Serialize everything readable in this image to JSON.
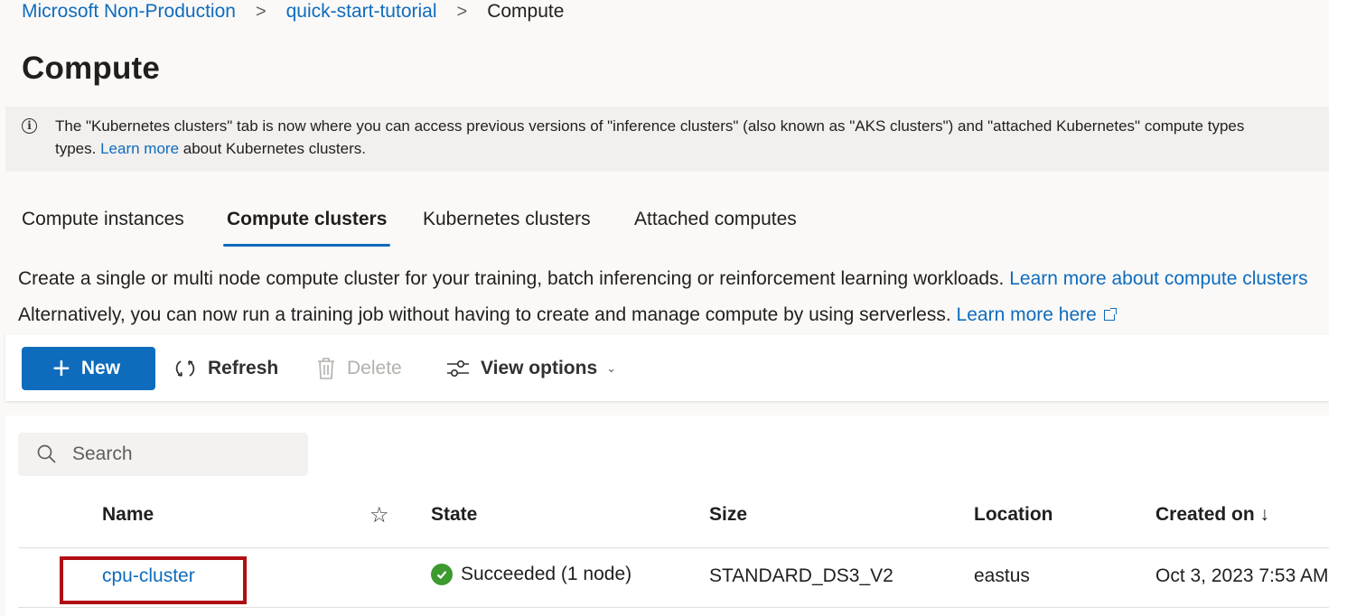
{
  "breadcrumb": {
    "items": [
      "Microsoft Non-Production",
      "quick-start-tutorial"
    ],
    "current": "Compute",
    "separator": ">"
  },
  "page": {
    "title": "Compute"
  },
  "banner": {
    "icon": "info-icon",
    "line1": "The \"Kubernetes clusters\" tab is now where you can access previous versions of \"inference clusters\" (also known as \"AKS clusters\") and \"attached Kubernetes\" compute types",
    "line2_pre": "types.",
    "line2_link": "Learn more",
    "line2_post": "about Kubernetes clusters."
  },
  "tabs": [
    {
      "label": "Compute instances",
      "active": false
    },
    {
      "label": "Compute clusters",
      "active": true
    },
    {
      "label": "Kubernetes clusters",
      "active": false
    },
    {
      "label": "Attached computes",
      "active": false
    }
  ],
  "description": {
    "line1": "Create a single or multi node compute cluster for your training, batch inferencing or reinforcement learning workloads.",
    "line1_link": "Learn more about compute clusters",
    "line2": "Alternatively, you can now run a training job without having to create and manage compute by using serverless.",
    "line2_link": "Learn more here"
  },
  "toolbar": {
    "new_label": "New",
    "refresh_label": "Refresh",
    "delete_label": "Delete",
    "view_options_label": "View options"
  },
  "search": {
    "placeholder": "Search",
    "value": ""
  },
  "table": {
    "columns": [
      "Name",
      "State",
      "Size",
      "Location",
      "Created on ↓"
    ],
    "favorite_icon": "star-icon",
    "rows": [
      {
        "name": "cpu-cluster",
        "state": "Succeeded (1 node)",
        "size": "STANDARD_DS3_V2",
        "location": "eastus",
        "created_on": "Oct 3, 2023 7:53 AM"
      }
    ]
  },
  "colors": {
    "accent": "#0f6cbd",
    "success": "#3c9a2f",
    "highlight_border": "#b00e14",
    "page_background": "#faf9f8",
    "banner_background": "#f1f0ef"
  }
}
